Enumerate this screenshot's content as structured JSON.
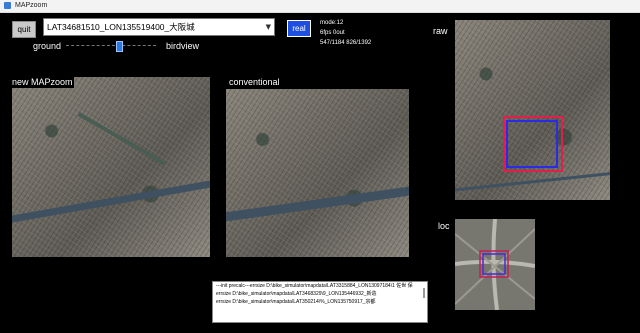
{
  "window": {
    "title": "MAPzoom"
  },
  "toolbar": {
    "quit_label": "quit",
    "location_value": "LAT34681510_LON135519400_大阪城",
    "real_label": "real"
  },
  "status": {
    "line1": "mode:12",
    "line2": "6fps 0out",
    "line3": "547/1184 826/1392"
  },
  "zoom_slider": {
    "left_label": "ground",
    "right_label": "birdview",
    "level": 0.58
  },
  "panels": {
    "new": "new MAPzoom",
    "conventional": "conventional",
    "raw": "raw",
    "loc": "loc"
  },
  "log": {
    "lines": [
      "---init precalc---errsize D:\\bike_simulator\\mapdata\\LAT3315884_LON13097184\\1 佐世 保",
      "errsize D:\\bike_simulator\\mapdata\\LAT3468329\\9_LON135446932_新造",
      "errsize D:\\bike_simulator\\mapdata\\LAT350214\\%_LON135750917_宗都"
    ]
  },
  "colors": {
    "background": "#000000",
    "real_button": "#1f4fe0",
    "raw_red_box": "#e0204a",
    "raw_blue_box": "#2a2ae8"
  }
}
